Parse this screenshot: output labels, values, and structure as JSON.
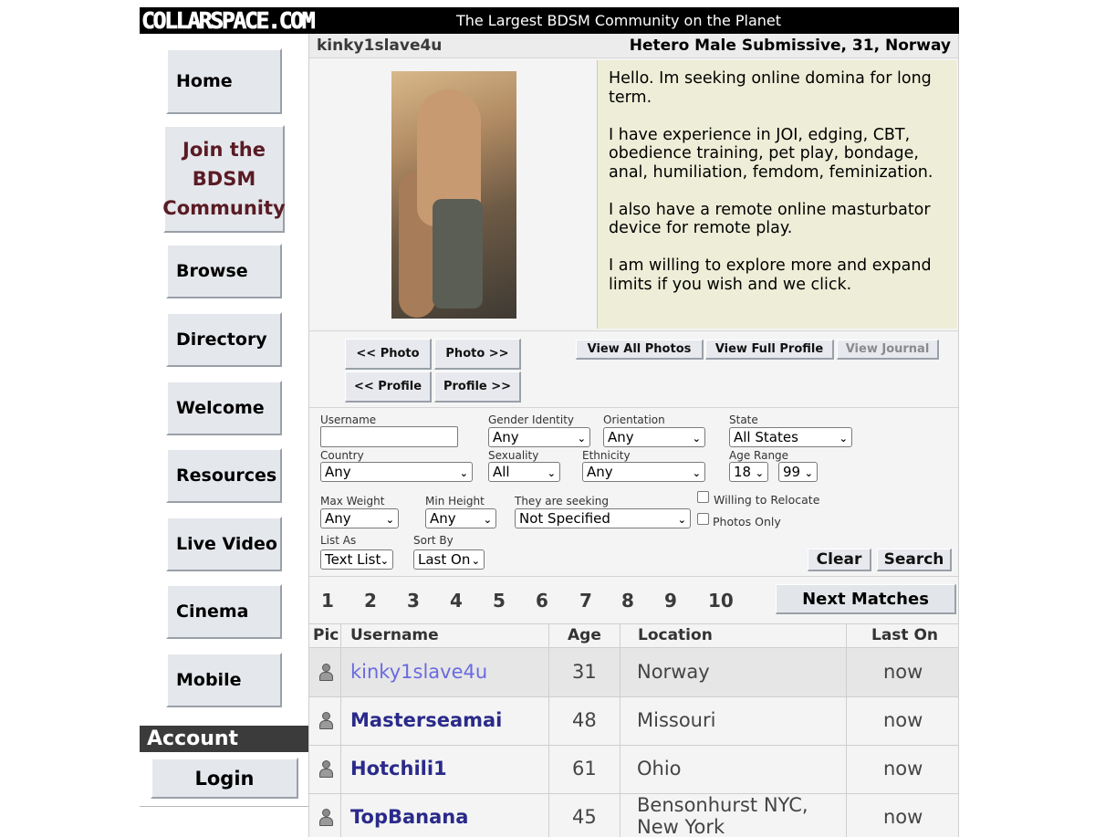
{
  "header": {
    "logo_text": "COLLARSPACE.COM",
    "tagline": "The Largest BDSM Community on the Planet"
  },
  "nav": {
    "home": "Home",
    "join_line1": "Join the",
    "join_line2": "BDSM",
    "join_line3": "Community",
    "browse": "Browse",
    "directory": "Directory",
    "welcome": "Welcome",
    "resources": "Resources",
    "live_video": "Live Video",
    "cinema": "Cinema",
    "mobile": "Mobile",
    "account_title": "Account",
    "login": "Login"
  },
  "profile": {
    "username": "kinky1slave4u",
    "summary": "Hetero Male Submissive, 31, Norway",
    "bio": [
      "Hello. Im seeking online domina for long term.",
      "I have experience in JOI, edging, CBT, obedience training, pet play, bondage, anal, humiliation, femdom, feminization.",
      "I also have a remote online masturbator device for remote play.",
      "I am willing to explore more and expand limits if you wish and we click."
    ]
  },
  "photo_nav": {
    "prev_photo": "<< Photo",
    "next_photo": "Photo >>",
    "prev_profile": "<< Profile",
    "next_profile": "Profile >>",
    "view_all_photos": "View All Photos",
    "view_full_profile": "View Full Profile",
    "view_journal": "View Journal"
  },
  "search": {
    "username_label": "Username",
    "username_value": "",
    "gender_label": "Gender Identity",
    "gender_value": "Any",
    "orientation_label": "Orientation",
    "orientation_value": "Any",
    "state_label": "State",
    "state_value": "All States",
    "country_label": "Country",
    "country_value": "Any",
    "sexuality_label": "Sexuality",
    "sexuality_value": "All",
    "ethnicity_label": "Ethnicity",
    "ethnicity_value": "Any",
    "age_label": "Age Range",
    "age_min": "18",
    "age_max": "99",
    "max_weight_label": "Max Weight",
    "max_weight_value": "Any",
    "min_height_label": "Min Height",
    "min_height_value": "Any",
    "seeking_label": "They are seeking",
    "seeking_value": "Not Specified",
    "relocate_label": "Willing to Relocate",
    "photos_only_label": "Photos Only",
    "list_as_label": "List As",
    "list_as_value": "Text List",
    "sort_by_label": "Sort By",
    "sort_by_value": "Last On",
    "clear": "Clear",
    "search": "Search"
  },
  "pager": {
    "pages": [
      "1",
      "2",
      "3",
      "4",
      "5",
      "6",
      "7",
      "8",
      "9",
      "10"
    ],
    "next": "Next Matches"
  },
  "table": {
    "headers": {
      "pic": "Pic",
      "username": "Username",
      "age": "Age",
      "location": "Location",
      "last_on": "Last On"
    },
    "rows": [
      {
        "username": "kinky1slave4u",
        "age": "31",
        "location": "Norway",
        "location2": "",
        "last_on": "now"
      },
      {
        "username": "Masterseamai",
        "age": "48",
        "location": "Missouri",
        "location2": "",
        "last_on": "now"
      },
      {
        "username": "Hotchili1",
        "age": "61",
        "location": "Ohio",
        "location2": "",
        "last_on": "now"
      },
      {
        "username": "TopBanana",
        "age": "45",
        "location": "Bensonhurst NYC,",
        "location2": "New York",
        "last_on": "now"
      }
    ]
  }
}
